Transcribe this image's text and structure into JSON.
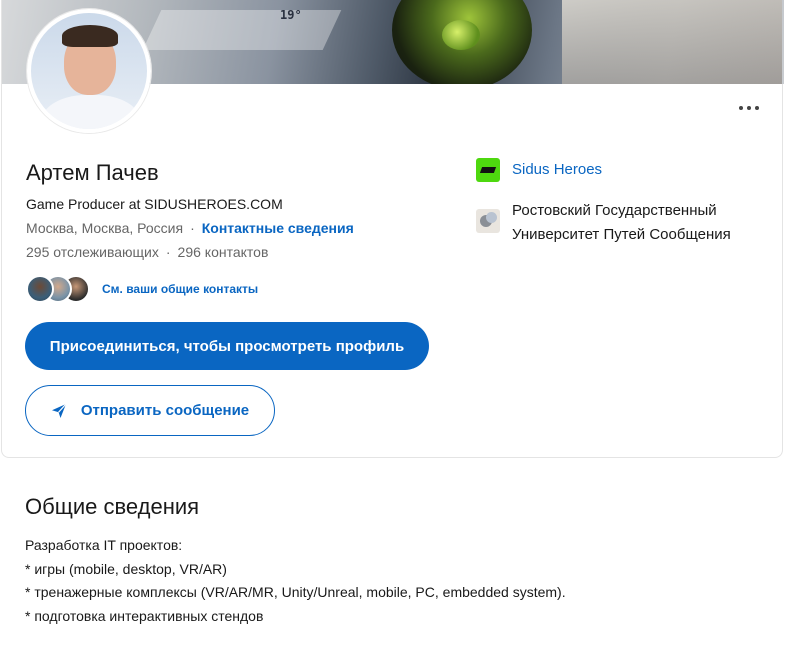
{
  "profile": {
    "name": "Артем Пачев",
    "headline": "Game Producer at SIDUSHEROES.COM",
    "location": "Москва, Москва, Россия",
    "separator": "·",
    "contact_info_label": "Контактные сведения",
    "followers": "295 отслеживающих",
    "connections": "296 контактов",
    "mutual_contacts_label": "См. ваши общие контакты"
  },
  "actions": {
    "join_label": "Присоединиться, чтобы просмотреть профиль",
    "message_label": "Отправить сообщение",
    "more_icon": "more-horizontal-icon",
    "send_icon": "paper-plane-icon"
  },
  "experience": {
    "company": "Sidus Heroes",
    "school": "Ростовский Государственный Университет Путей Сообщения"
  },
  "about": {
    "title": "Общие сведения",
    "lines": [
      "Разработка IT проектов:",
      "* игры (mobile, desktop, VR/AR)",
      "* тренажерные комплексы (VR/AR/MR, Unity/Unreal, mobile, PC, embedded system).",
      "* подготовка интерактивных стендов"
    ]
  },
  "banner": {
    "tag": "19°"
  },
  "colors": {
    "primary": "#0a66c2",
    "text": "#191919",
    "muted": "#666666",
    "sidus_logo": "#4ed80f"
  }
}
